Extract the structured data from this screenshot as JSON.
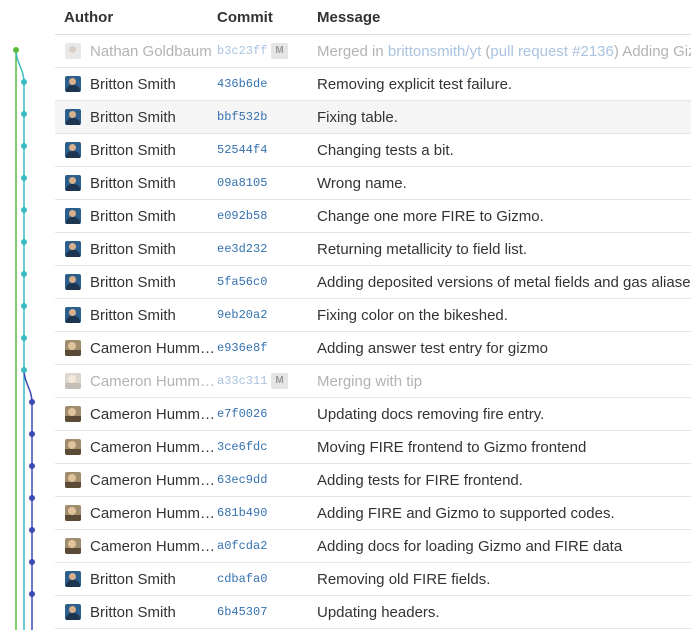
{
  "headers": {
    "author": "Author",
    "commit": "Commit",
    "message": "Message"
  },
  "merge_badge": "M",
  "merge_message": {
    "prefix": "Merged in ",
    "branch": "brittonsmith/yt",
    "open_paren": " (",
    "pr": "pull request #2136",
    "rest": ") Adding Gizmo frontend."
  },
  "colors": {
    "main_branch": "#5cbb3c",
    "teal_branch": "#3bbcc4",
    "purple_branch": "#3d4ab5",
    "link": "#3572b0"
  },
  "commits": [
    {
      "author": "Nathan Goldbaum",
      "avatar": "nathan",
      "hash": "b3c23ff",
      "merge": true,
      "message": ""
    },
    {
      "author": "Britton Smith",
      "avatar": "britton",
      "hash": "436b6de",
      "merge": false,
      "message": "Removing explicit test failure."
    },
    {
      "author": "Britton Smith",
      "avatar": "britton",
      "hash": "bbf532b",
      "merge": false,
      "message": "Fixing table."
    },
    {
      "author": "Britton Smith",
      "avatar": "britton",
      "hash": "52544f4",
      "merge": false,
      "message": "Changing tests a bit."
    },
    {
      "author": "Britton Smith",
      "avatar": "britton",
      "hash": "09a8105",
      "merge": false,
      "message": "Wrong name."
    },
    {
      "author": "Britton Smith",
      "avatar": "britton",
      "hash": "e092b58",
      "merge": false,
      "message": "Change one more FIRE to Gizmo."
    },
    {
      "author": "Britton Smith",
      "avatar": "britton",
      "hash": "ee3d232",
      "merge": false,
      "message": "Returning metallicity to field list."
    },
    {
      "author": "Britton Smith",
      "avatar": "britton",
      "hash": "5fa56c0",
      "merge": false,
      "message": "Adding deposited versions of metal fields and gas aliases."
    },
    {
      "author": "Britton Smith",
      "avatar": "britton",
      "hash": "9eb20a2",
      "merge": false,
      "message": "Fixing color on the bikeshed."
    },
    {
      "author": "Cameron Hummels",
      "avatar": "cameron",
      "hash": "e936e8f",
      "merge": false,
      "message": "Adding answer test entry for gizmo"
    },
    {
      "author": "Cameron Hummels",
      "avatar": "cameron",
      "hash": "a33c311",
      "merge": true,
      "message": "Merging with tip"
    },
    {
      "author": "Cameron Hummels",
      "avatar": "cameron",
      "hash": "e7f0026",
      "merge": false,
      "message": "Updating docs removing fire entry."
    },
    {
      "author": "Cameron Hummels",
      "avatar": "cameron",
      "hash": "3ce6fdc",
      "merge": false,
      "message": "Moving FIRE frontend to Gizmo frontend"
    },
    {
      "author": "Cameron Hummels",
      "avatar": "cameron",
      "hash": "63ec9dd",
      "merge": false,
      "message": "Adding tests for FIRE frontend."
    },
    {
      "author": "Cameron Hummels",
      "avatar": "cameron",
      "hash": "681b490",
      "merge": false,
      "message": "Adding FIRE and Gizmo to supported codes."
    },
    {
      "author": "Cameron Hummels",
      "avatar": "cameron",
      "hash": "a0fcda2",
      "merge": false,
      "message": "Adding docs for loading Gizmo and FIRE data"
    },
    {
      "author": "Britton Smith",
      "avatar": "britton",
      "hash": "cdbafa0",
      "merge": false,
      "message": "Removing old FIRE fields."
    },
    {
      "author": "Britton Smith",
      "avatar": "britton",
      "hash": "6b45307",
      "merge": false,
      "message": "Updating headers."
    }
  ]
}
